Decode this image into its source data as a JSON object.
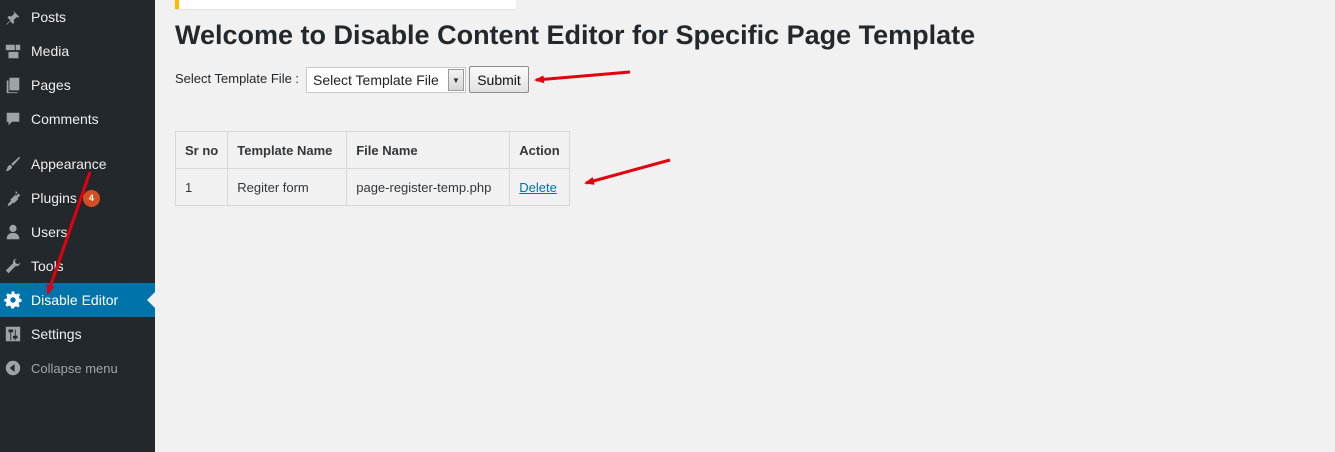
{
  "sidebar": {
    "items": [
      {
        "label": "Posts",
        "icon": "pushpin-icon"
      },
      {
        "label": "Media",
        "icon": "media-icon"
      },
      {
        "label": "Pages",
        "icon": "pages-icon"
      },
      {
        "label": "Comments",
        "icon": "comment-icon"
      },
      {
        "label": "Appearance",
        "icon": "paintbrush-icon"
      },
      {
        "label": "Plugins",
        "icon": "plugin-icon",
        "badge": "4"
      },
      {
        "label": "Users",
        "icon": "user-icon"
      },
      {
        "label": "Tools",
        "icon": "wrench-icon"
      },
      {
        "label": "Disable Editor",
        "icon": "gear-icon",
        "active": true
      },
      {
        "label": "Settings",
        "icon": "settings-icon"
      }
    ],
    "collapse_label": "Collapse menu"
  },
  "main": {
    "title": "Welcome to Disable Content Editor for Specific Page Template",
    "select_label": "Select Template File :",
    "select_value": "Select Template File",
    "submit_label": "Submit",
    "table": {
      "headers": [
        "Sr no",
        "Template Name",
        "File Name",
        "Action"
      ],
      "rows": [
        {
          "sr": "1",
          "template": "Regiter form",
          "file": "page-register-temp.php",
          "action": "Delete"
        }
      ]
    }
  },
  "colors": {
    "sidebar_bg": "#23282d",
    "active_bg": "#0073aa",
    "badge_bg": "#d54e21",
    "annotation_arrow": "#e3000f"
  }
}
